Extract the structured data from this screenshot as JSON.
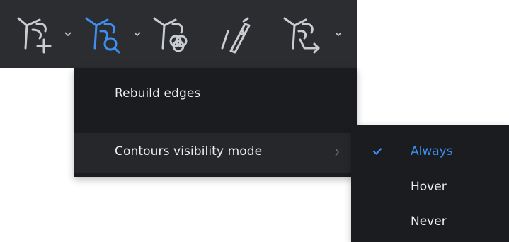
{
  "toolbar": {
    "tools": [
      {
        "icon": "branch-add-icon",
        "has_dropdown": true
      },
      {
        "icon": "branch-inspect-icon",
        "has_dropdown": true,
        "active": true
      },
      {
        "icon": "branch-overlap-icon",
        "has_dropdown": false
      },
      {
        "icon": "cut-edge-icon",
        "has_dropdown": false
      },
      {
        "icon": "branch-redirect-icon",
        "has_dropdown": true
      }
    ]
  },
  "menu": {
    "rebuild_edges": "Rebuild edges",
    "contours_visibility_mode": "Contours visibility mode"
  },
  "submenu": {
    "options": [
      "Always",
      "Hover",
      "Never"
    ],
    "selected": "Always"
  },
  "colors": {
    "toolbar_bg": "#2b2d31",
    "menu_bg": "#1b1c1f",
    "hover_bg": "#26272b",
    "text": "#eceff3",
    "accent": "#3d8ff0",
    "icon": "#c9ccd1"
  }
}
